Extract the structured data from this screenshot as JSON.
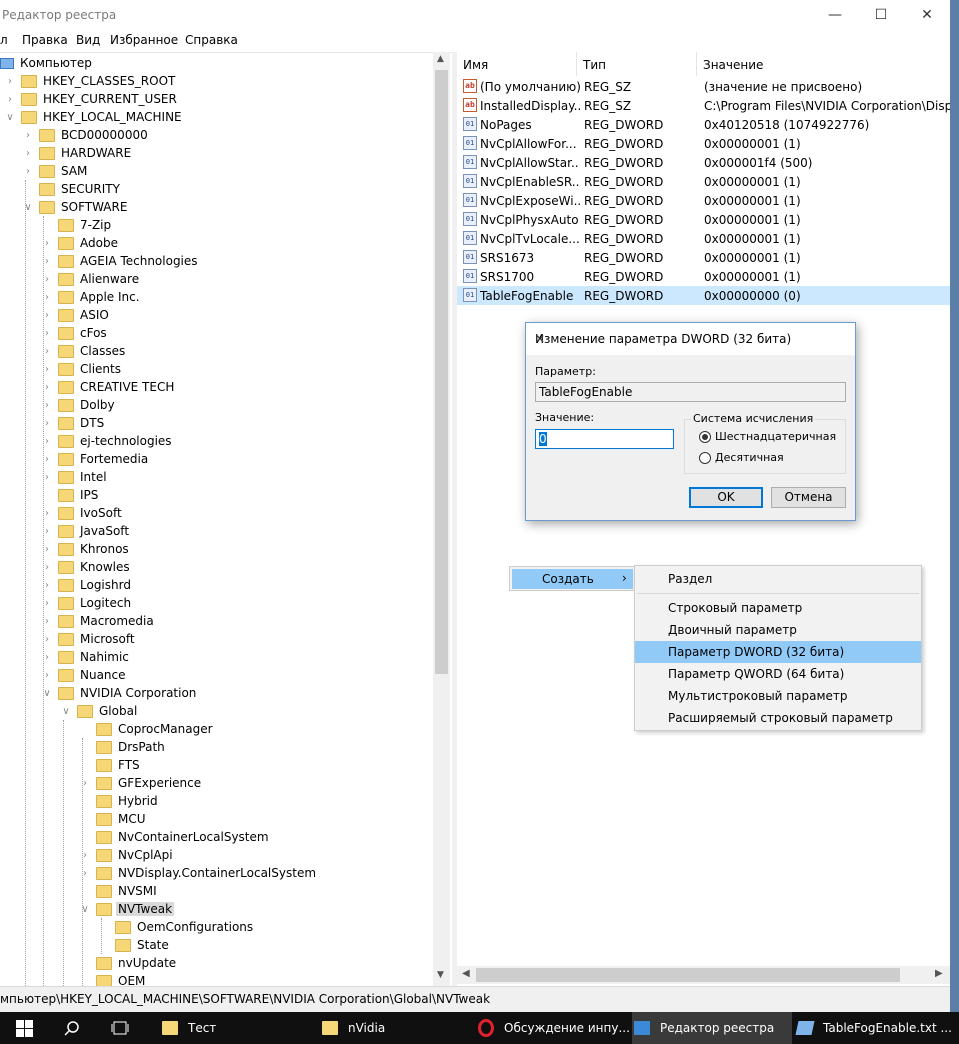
{
  "window": {
    "title": "Редактор реестра"
  },
  "menu": [
    "л",
    "Правка",
    "Вид",
    "Избранное",
    "Справка"
  ],
  "tree": {
    "root": "Компьютер",
    "items": [
      {
        "label": "HKEY_CLASSES_ROOT",
        "level": 1,
        "arrow": ">"
      },
      {
        "label": "HKEY_CURRENT_USER",
        "level": 1,
        "arrow": ">"
      },
      {
        "label": "HKEY_LOCAL_MACHINE",
        "level": 1,
        "arrow": "v"
      },
      {
        "label": "BCD00000000",
        "level": 2,
        "arrow": ">"
      },
      {
        "label": "HARDWARE",
        "level": 2,
        "arrow": ">"
      },
      {
        "label": "SAM",
        "level": 2,
        "arrow": ">"
      },
      {
        "label": "SECURITY",
        "level": 2,
        "arrow": ""
      },
      {
        "label": "SOFTWARE",
        "level": 2,
        "arrow": "v"
      },
      {
        "label": "7-Zip",
        "level": 3,
        "arrow": ""
      },
      {
        "label": "Adobe",
        "level": 3,
        "arrow": ">"
      },
      {
        "label": "AGEIA Technologies",
        "level": 3,
        "arrow": ">"
      },
      {
        "label": "Alienware",
        "level": 3,
        "arrow": ">"
      },
      {
        "label": "Apple Inc.",
        "level": 3,
        "arrow": ">"
      },
      {
        "label": "ASIO",
        "level": 3,
        "arrow": ">"
      },
      {
        "label": "cFos",
        "level": 3,
        "arrow": ">"
      },
      {
        "label": "Classes",
        "level": 3,
        "arrow": ">"
      },
      {
        "label": "Clients",
        "level": 3,
        "arrow": ">"
      },
      {
        "label": "CREATIVE TECH",
        "level": 3,
        "arrow": ">"
      },
      {
        "label": "Dolby",
        "level": 3,
        "arrow": ">"
      },
      {
        "label": "DTS",
        "level": 3,
        "arrow": ">"
      },
      {
        "label": "ej-technologies",
        "level": 3,
        "arrow": ">"
      },
      {
        "label": "Fortemedia",
        "level": 3,
        "arrow": ">"
      },
      {
        "label": "Intel",
        "level": 3,
        "arrow": ">"
      },
      {
        "label": "IPS",
        "level": 3,
        "arrow": ""
      },
      {
        "label": "IvoSoft",
        "level": 3,
        "arrow": ">"
      },
      {
        "label": "JavaSoft",
        "level": 3,
        "arrow": ">"
      },
      {
        "label": "Khronos",
        "level": 3,
        "arrow": ">"
      },
      {
        "label": "Knowles",
        "level": 3,
        "arrow": ">"
      },
      {
        "label": "Logishrd",
        "level": 3,
        "arrow": ">"
      },
      {
        "label": "Logitech",
        "level": 3,
        "arrow": ">"
      },
      {
        "label": "Macromedia",
        "level": 3,
        "arrow": ">"
      },
      {
        "label": "Microsoft",
        "level": 3,
        "arrow": ">"
      },
      {
        "label": "Nahimic",
        "level": 3,
        "arrow": ">"
      },
      {
        "label": "Nuance",
        "level": 3,
        "arrow": ">"
      },
      {
        "label": "NVIDIA Corporation",
        "level": 3,
        "arrow": "v"
      },
      {
        "label": "Global",
        "level": 4,
        "arrow": "v"
      },
      {
        "label": "CoprocManager",
        "level": 5,
        "arrow": ""
      },
      {
        "label": "DrsPath",
        "level": 5,
        "arrow": ""
      },
      {
        "label": "FTS",
        "level": 5,
        "arrow": ""
      },
      {
        "label": "GFExperience",
        "level": 5,
        "arrow": ">"
      },
      {
        "label": "Hybrid",
        "level": 5,
        "arrow": ""
      },
      {
        "label": "MCU",
        "level": 5,
        "arrow": ""
      },
      {
        "label": "NvContainerLocalSystem",
        "level": 5,
        "arrow": ""
      },
      {
        "label": "NvCplApi",
        "level": 5,
        "arrow": ">"
      },
      {
        "label": "NVDisplay.ContainerLocalSystem",
        "level": 5,
        "arrow": ">"
      },
      {
        "label": "NVSMI",
        "level": 5,
        "arrow": ""
      },
      {
        "label": "NVTweak",
        "level": 5,
        "arrow": "v",
        "selected": true
      },
      {
        "label": "OemConfigurations",
        "level": 6,
        "arrow": ""
      },
      {
        "label": "State",
        "level": 6,
        "arrow": ""
      },
      {
        "label": "nvUpdate",
        "level": 5,
        "arrow": ""
      },
      {
        "label": "OEM",
        "level": 5,
        "arrow": ""
      }
    ]
  },
  "list": {
    "headers": {
      "name": "Имя",
      "type": "Тип",
      "value": "Значение"
    },
    "rows": [
      {
        "icon": "ab",
        "name": "(По умолчанию)",
        "type": "REG_SZ",
        "value": "(значение не присвоено)"
      },
      {
        "icon": "ab",
        "name": "InstalledDisplay...",
        "type": "REG_SZ",
        "value": "C:\\Program Files\\NVIDIA Corporation\\Display\\"
      },
      {
        "icon": "bin",
        "name": "NoPages",
        "type": "REG_DWORD",
        "value": "0x40120518 (1074922776)"
      },
      {
        "icon": "bin",
        "name": "NvCplAllowFor...",
        "type": "REG_DWORD",
        "value": "0x00000001 (1)"
      },
      {
        "icon": "bin",
        "name": "NvCplAllowStar...",
        "type": "REG_DWORD",
        "value": "0x000001f4 (500)"
      },
      {
        "icon": "bin",
        "name": "NvCplEnableSR...",
        "type": "REG_DWORD",
        "value": "0x00000001 (1)"
      },
      {
        "icon": "bin",
        "name": "NvCplExposeWi...",
        "type": "REG_DWORD",
        "value": "0x00000001 (1)"
      },
      {
        "icon": "bin",
        "name": "NvCplPhysxAuto",
        "type": "REG_DWORD",
        "value": "0x00000001 (1)"
      },
      {
        "icon": "bin",
        "name": "NvCplTvLocale...",
        "type": "REG_DWORD",
        "value": "0x00000001 (1)"
      },
      {
        "icon": "bin",
        "name": "SRS1673",
        "type": "REG_DWORD",
        "value": "0x00000001 (1)"
      },
      {
        "icon": "bin",
        "name": "SRS1700",
        "type": "REG_DWORD",
        "value": "0x00000001 (1)"
      },
      {
        "icon": "bin",
        "name": "TableFogEnable",
        "type": "REG_DWORD",
        "value": "0x00000000 (0)",
        "selected": true
      }
    ]
  },
  "dialog": {
    "title": "Изменение параметра DWORD (32 бита)",
    "param_label": "Параметр:",
    "param_value": "TableFogEnable",
    "value_label": "Значение:",
    "value": "0",
    "base_group": "Система исчисления",
    "hex": "Шестнадцатеричная",
    "dec": "Десятичная",
    "ok": "OK",
    "cancel": "Отмена"
  },
  "context": {
    "create": "Создать",
    "items": [
      "Раздел",
      "Строковый параметр",
      "Двоичный параметр",
      "Параметр DWORD (32 бита)",
      "Параметр QWORD (64 бита)",
      "Мультистроковый параметр",
      "Расширяемый строковый параметр"
    ]
  },
  "statusbar": "мпьютер\\HKEY_LOCAL_MACHINE\\SOFTWARE\\NVIDIA Corporation\\Global\\NVTweak",
  "taskbar": [
    {
      "label": "Тест",
      "icon": "folder-icon"
    },
    {
      "label": "nVidia",
      "icon": "folder-icon"
    },
    {
      "label": "Обсуждение инпу...",
      "icon": "opera-icon"
    },
    {
      "label": "Редактор реестра",
      "icon": "regedit-icon",
      "active": true
    },
    {
      "label": "TableFogEnable.txt ...",
      "icon": "notepad-icon"
    }
  ]
}
